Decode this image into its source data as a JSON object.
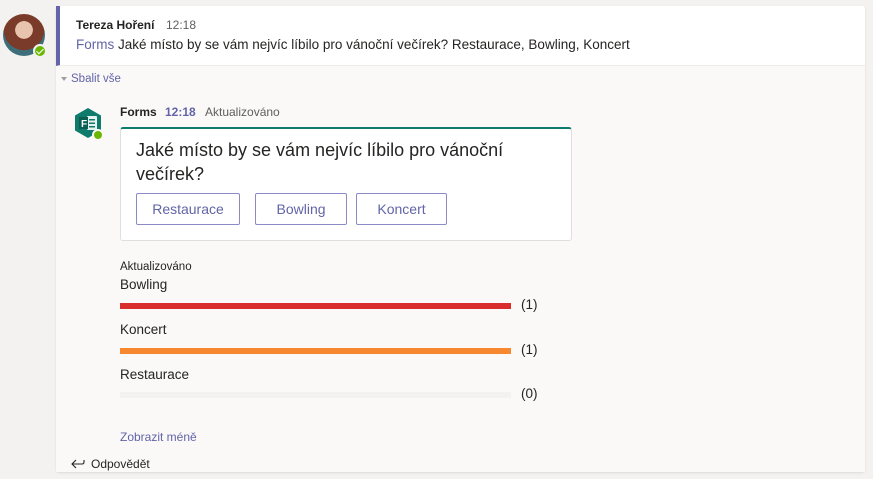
{
  "parent_message": {
    "author": "Tereza Hoření",
    "time": "12:18",
    "link_text": "Forms",
    "text": " Jaké místo by se vám nejvíc líbilo pro vánoční večírek? Restaurace, Bowling, Koncert"
  },
  "thread": {
    "collapse_label": "Sbalit vše",
    "show_less_label": "Zobrazit méně",
    "reply_label": "Odpovědět"
  },
  "bot_message": {
    "name": "Forms",
    "time": "12:18",
    "status": "Aktualizováno",
    "icon": "forms-app-icon"
  },
  "poll": {
    "question": "Jaké místo by se vám nejvíc líbilo pro vánoční večírek?",
    "options": [
      "Restaurace",
      "Bowling",
      "Koncert"
    ],
    "results_status": "Aktualizováno",
    "results": [
      {
        "label": "Bowling",
        "count": "(1)",
        "share": 1.0,
        "color": "#d92c2c"
      },
      {
        "label": "Koncert",
        "count": "(1)",
        "share": 1.0,
        "color": "#f7882f"
      },
      {
        "label": "Restaurace",
        "count": "(0)",
        "share": 0.0,
        "color": "#f3f2f1"
      }
    ]
  },
  "colors": {
    "accent": "#6264a7",
    "forms_green": "#0f7b6c",
    "presence_available": "#6bb700"
  }
}
